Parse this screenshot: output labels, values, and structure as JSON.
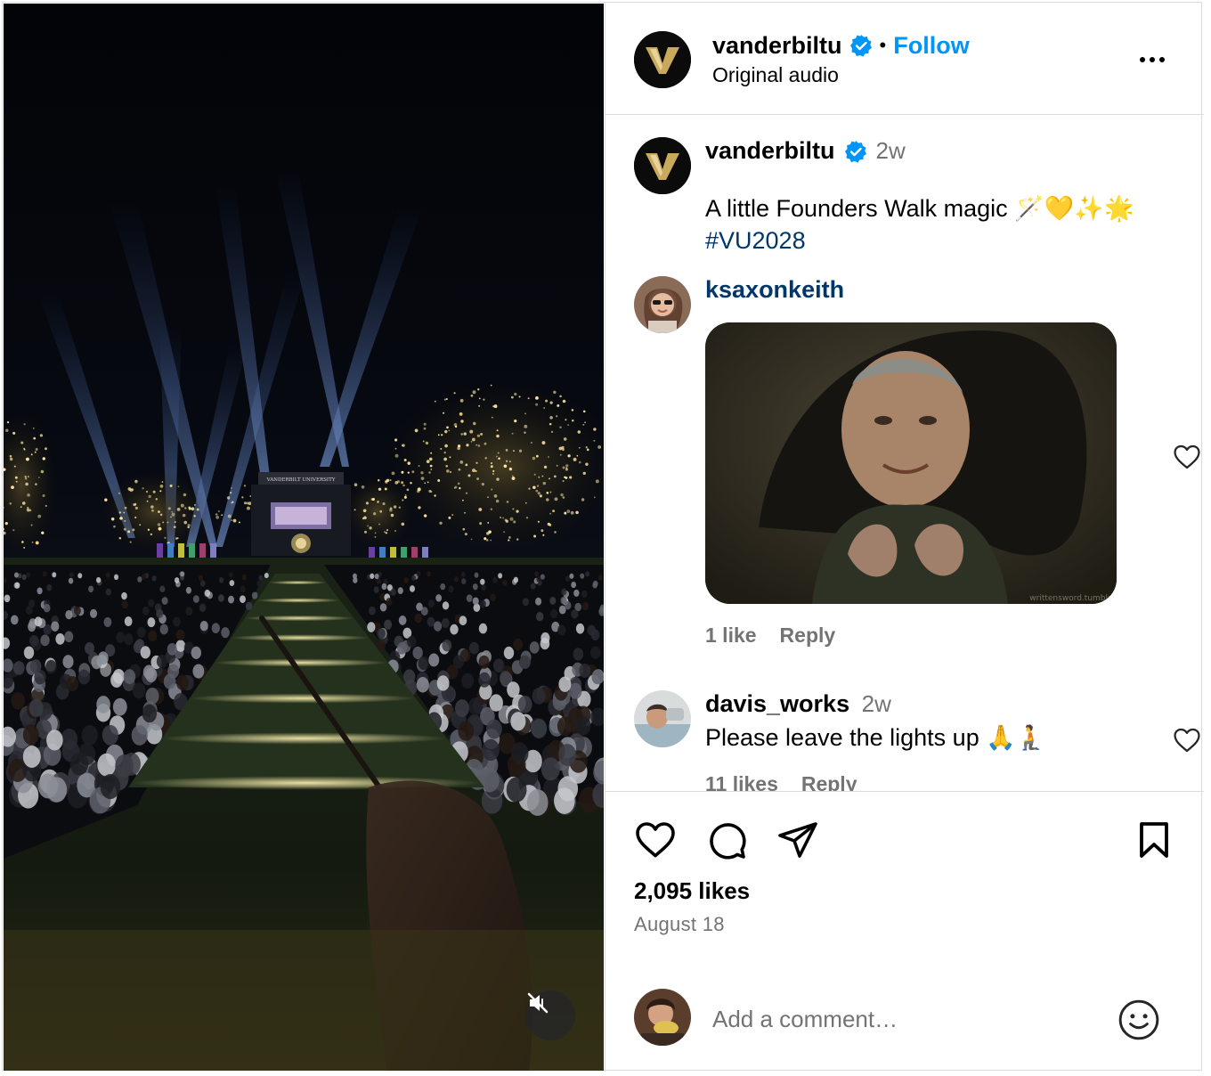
{
  "post": {
    "username": "vanderbiltu",
    "follow_label": "Follow",
    "separator": "•",
    "audio_label": "Original audio"
  },
  "caption": {
    "username": "vanderbiltu",
    "time": "2w",
    "text": "A little Founders Walk magic 🪄💛✨🌟",
    "hashtag": "#VU2028"
  },
  "comments": [
    {
      "username": "ksaxonkeith",
      "likes_label": "1 like",
      "reply_label": "Reply",
      "gif_watermark": "writtensword.tumblr"
    },
    {
      "username": "davis_works",
      "time": "2w",
      "text": "Please leave the lights up 🙏🧎",
      "likes_label": "11 likes",
      "reply_label": "Reply"
    }
  ],
  "stage_sign": "VANDERBILT UNIVERSITY",
  "actions": {
    "likes_count": "2,095 likes",
    "date": "August 18"
  },
  "composer": {
    "placeholder": "Add a comment…"
  },
  "icons": {
    "verified": "verified-badge-icon",
    "more": "more-options-icon",
    "like": "heart-icon",
    "comment": "comment-bubble-icon",
    "share": "paper-plane-icon",
    "save": "bookmark-icon",
    "emoji": "smiley-icon",
    "mute": "speaker-muted-icon"
  },
  "colors": {
    "follow": "#0095f6",
    "hashtag": "#00376b",
    "username_link": "#00376b",
    "muted_text": "#737373",
    "verified": "#0095f6",
    "brand_gold": "#c9a95b"
  }
}
